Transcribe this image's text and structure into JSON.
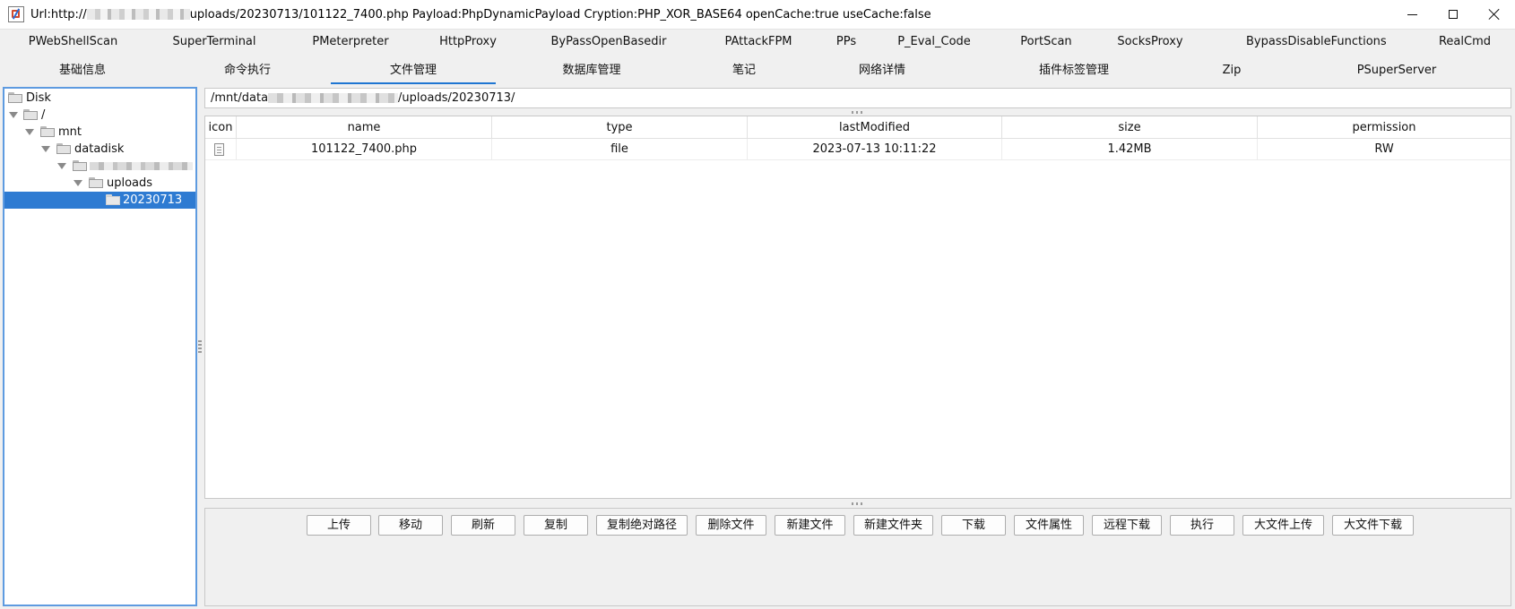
{
  "window": {
    "title_prefix": "Url:http://",
    "title_suffix": "uploads/20230713/101122_7400.php Payload:PhpDynamicPayload Cryption:PHP_XOR_BASE64 openCache:true useCache:false"
  },
  "plugin_tabs": [
    "PWebShellScan",
    "SuperTerminal",
    "PMeterpreter",
    "HttpProxy",
    "ByPassOpenBasedir",
    "PAttackFPM",
    "PPs",
    "P_Eval_Code",
    "PortScan",
    "SocksProxy",
    "BypassDisableFunctions",
    "RealCmd"
  ],
  "main_tabs": [
    "基础信息",
    "命令执行",
    "文件管理",
    "数据库管理",
    "笔记",
    "网络详情",
    "插件标签管理",
    "Zip",
    "PSuperServer"
  ],
  "active_tab": "文件管理",
  "tree": {
    "root": "Disk",
    "nodes": [
      "/",
      "mnt",
      "datadisk",
      "uploads",
      "20230713"
    ],
    "selected": "20230713"
  },
  "path": {
    "prefix": "/mnt/data",
    "suffix": "/uploads/20230713/"
  },
  "table": {
    "columns": [
      "icon",
      "name",
      "type",
      "lastModified",
      "size",
      "permission"
    ],
    "rows": [
      {
        "icon": "file-icon",
        "name": "101122_7400.php",
        "type": "file",
        "lastModified": "2023-07-13 10:11:22",
        "size": "1.42MB",
        "permission": "RW"
      }
    ]
  },
  "actions": [
    "上传",
    "移动",
    "刷新",
    "复制",
    "复制绝对路径",
    "删除文件",
    "新建文件",
    "新建文件夹",
    "下载",
    "文件属性",
    "远程下载",
    "执行",
    "大文件上传",
    "大文件下载"
  ]
}
